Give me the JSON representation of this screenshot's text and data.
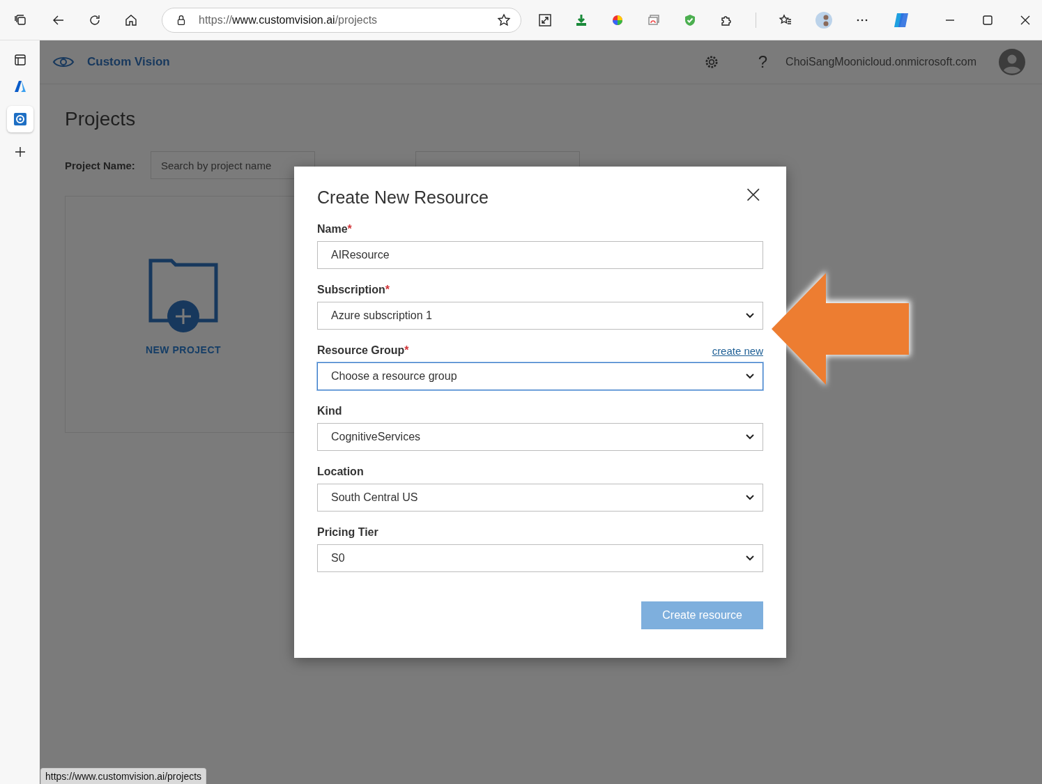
{
  "browser": {
    "url": {
      "scheme": "https://",
      "host": "www.customvision.ai",
      "path": "/projects"
    },
    "status_link": "https://www.customvision.ai/projects"
  },
  "header": {
    "app_name": "Custom Vision",
    "account": "ChoiSangMoonicloud.onmicrosoft.com",
    "help": "?"
  },
  "page": {
    "title": "Projects",
    "filter_label": "Project Name:",
    "search": {
      "placeholder": "Search by project name"
    },
    "new_project": "NEW PROJECT"
  },
  "dialog": {
    "title": "Create New Resource",
    "close": "×",
    "fields": [
      {
        "kind": "text",
        "label": "Name",
        "required": true,
        "value": "AIResource",
        "focused": false
      },
      {
        "kind": "select",
        "label": "Subscription",
        "required": true,
        "value": "Azure subscription 1",
        "focused": false
      },
      {
        "kind": "select",
        "label": "Resource Group",
        "required": true,
        "value": "Choose a resource group",
        "focused": true,
        "link": "create new"
      },
      {
        "kind": "select",
        "label": "Kind",
        "required": false,
        "value": "CognitiveServices",
        "focused": false
      },
      {
        "kind": "select",
        "label": "Location",
        "required": false,
        "value": "South Central US",
        "focused": false
      },
      {
        "kind": "select",
        "label": "Pricing Tier",
        "required": false,
        "value": "S0",
        "focused": false
      }
    ],
    "submit": {
      "label": "Create resource",
      "disabled": true
    }
  },
  "required_mark": "*"
}
